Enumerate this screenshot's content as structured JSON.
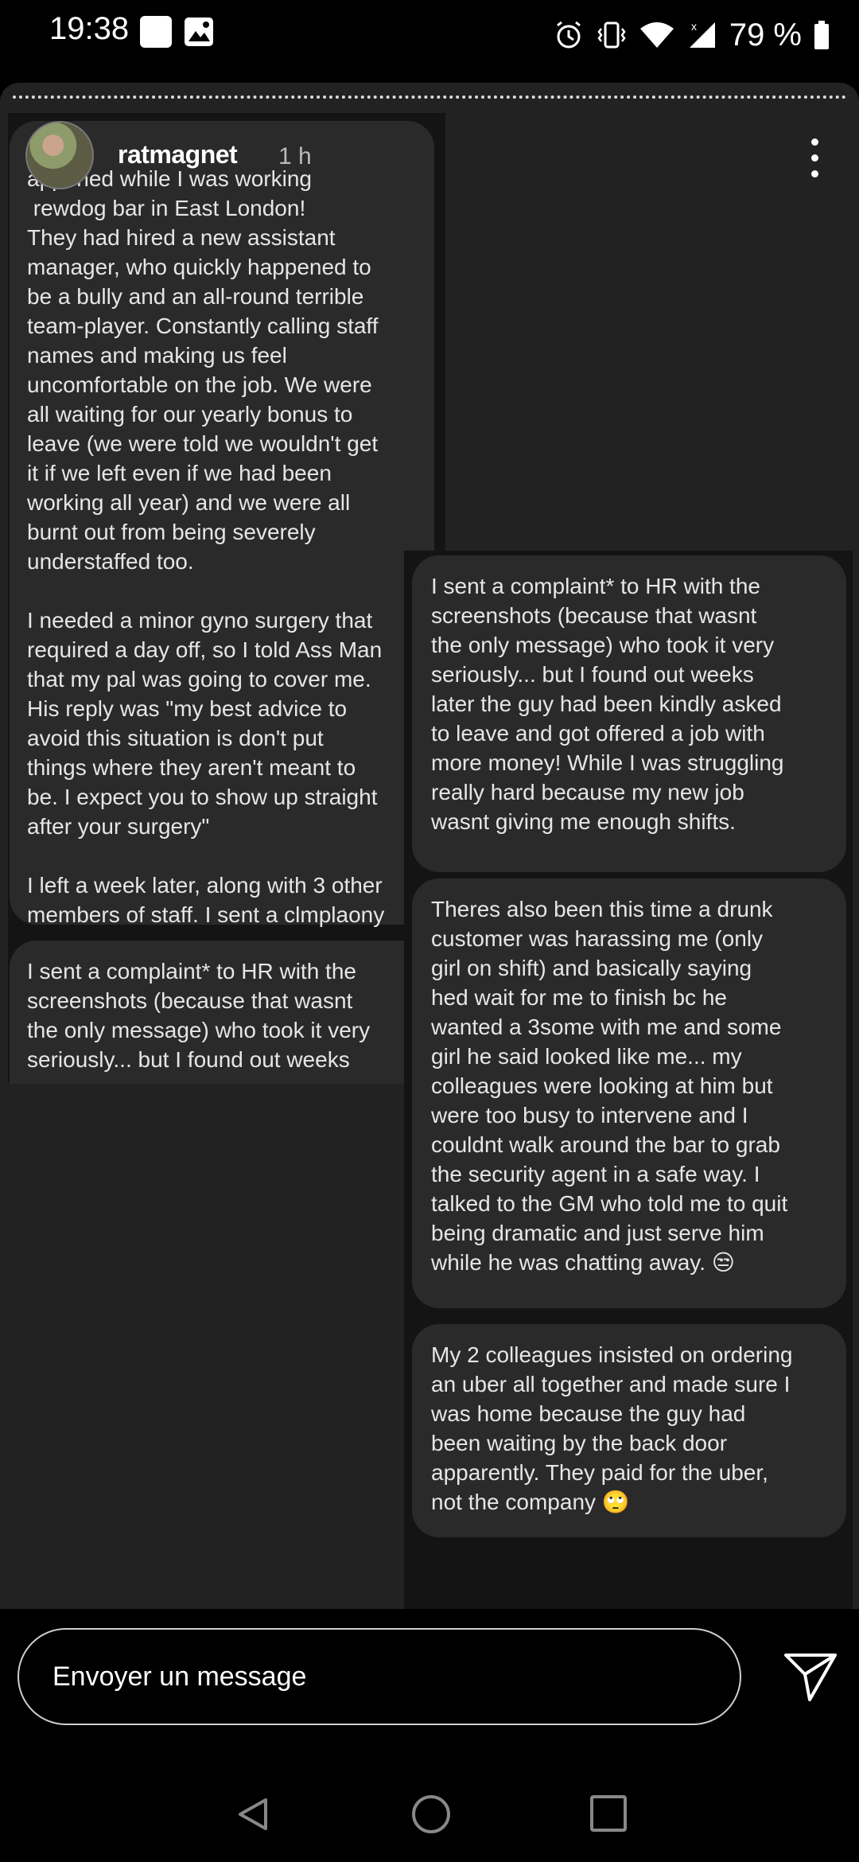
{
  "status_bar": {
    "time": "19:38",
    "battery": "79 %",
    "icons": [
      "notification-square-icon",
      "image-icon",
      "alarm-icon",
      "vibrate-icon",
      "wifi-icon",
      "signal-icon",
      "battery-icon"
    ]
  },
  "story": {
    "username": "ratmagnet",
    "time_ago": "1 h",
    "messages_left": [
      "appened while I was working\n rewdog bar in East London!\nThey had hired a new assistant\nmanager, who quickly happened to\nbe a bully and an all-round terrible\nteam-player. Constantly calling staff\nnames and making us feel\nuncomfortable on the job. We were\nall waiting for our yearly bonus to\nleave (we were told we wouldn't get\nit if we left even if we had been\nworking all year) and we were all\nburnt out from being severely\nunderstaffed too.\n\nI needed a minor gyno surgery that\nrequired a day off, so I told Ass Man\nthat my pal was going to cover me.\nHis reply was \"my best advice to\navoid this situation is don't put\nthings where they aren't meant to\nbe. I expect you to show up straight\nafter your surgery\"\n\nI left a week later, along with 3 other\nmembers of staff. I sent a clmplaony",
      "I sent a complaint* to HR with the\nscreenshots (because that wasnt\nthe only message) who took it very\nseriously... but I found out weeks"
    ],
    "messages_right": [
      "I sent a complaint* to HR with the\nscreenshots (because that wasnt\nthe only message) who took it very\nseriously... but I found out weeks\nlater the guy had been kindly asked\nto leave and got offered a job with\nmore money! While I was struggling\nreally hard because my new job\nwasnt giving me enough shifts.",
      "Theres also been this time a drunk\ncustomer was harassing me (only\ngirl on shift) and basically saying\nhed wait for me to finish bc he\nwanted a 3some with me and some\ngirl he said looked like me... my\ncolleagues were looking at him but\nwere too busy to intervene and I\ncouldnt walk around the bar to grab\nthe security agent in a safe way. I\ntalked to the GM who told me to quit\nbeing dramatic and just serve him\nwhile he was chatting away. 😒",
      "My 2 colleagues insisted on ordering\nan uber all together and made sure I\nwas home because the guy had\nbeen waiting by the back door\napparently. They paid for the uber,\nnot the company 🙄"
    ]
  },
  "reply": {
    "placeholder": "Envoyer un message"
  },
  "nav": {
    "icons": [
      "back-icon",
      "home-icon",
      "recents-icon"
    ]
  }
}
